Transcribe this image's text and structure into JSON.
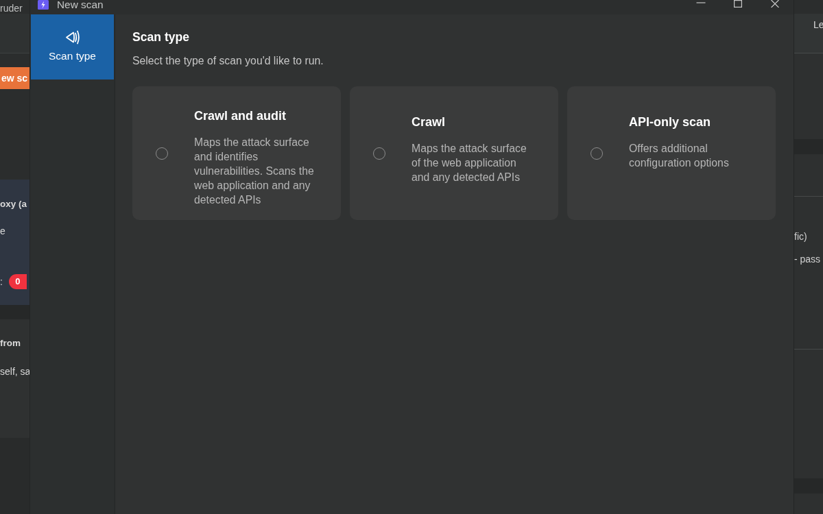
{
  "background_app": {
    "title": "ruder",
    "left_panel": {
      "button": "ew sc",
      "card_1": {
        "title": "oxy (a",
        "line_1": "e",
        "line_2": ":",
        "badge": "0"
      },
      "card_2": {
        "title": "from",
        "text": "self, sa"
      }
    },
    "right_panel": {
      "tab": "Le",
      "line_1": "fic)",
      "line_2": "- pass"
    }
  },
  "dialog": {
    "title": "New scan",
    "nav": [
      {
        "label": "Scan type",
        "selected": true
      }
    ],
    "heading": "Scan type",
    "subtitle": "Select the type of scan you'd like to run.",
    "options": [
      {
        "title": "Crawl and audit",
        "description": "Maps the attack surface and identifies vulnerabilities. Scans the web application and any detected APIs",
        "selected": false
      },
      {
        "title": "Crawl",
        "description": "Maps the attack surface of the web application and any detected APIs",
        "selected": false
      },
      {
        "title": "API-only scan",
        "description": "Offers additional configuration options",
        "selected": false
      }
    ]
  }
}
